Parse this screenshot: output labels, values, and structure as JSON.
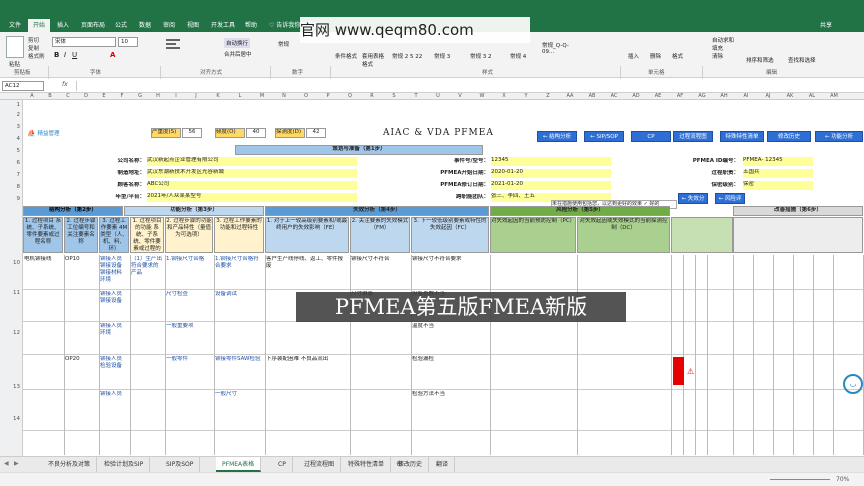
{
  "window": {
    "title": "PFMEA第五版FMEA新版 - Excel",
    "user": "共享"
  },
  "ribbon_tabs": [
    "文件",
    "开始",
    "插入",
    "页面布局",
    "公式",
    "数据",
    "审阅",
    "视图",
    "开发工具",
    "帮助",
    "♡ 告诉我你想要做什么"
  ],
  "ribbon": {
    "clipboard": "剪贴板",
    "paste": "粘贴",
    "cut": "剪切",
    "copy": "复制",
    "format_painter": "格式刷",
    "font_group": "字体",
    "font_name": "宋体",
    "font_size": "10",
    "align_group": "对齐方式",
    "wrap": "自动换行",
    "merge": "合并后居中",
    "number_group": "数字",
    "number_format": "常规",
    "styles_group": "样式",
    "cond_format": "条件格式",
    "table_format": "套用表格格式",
    "style_names": [
      "常规 2 5 22",
      "常规 3",
      "常规 3 2",
      "常规 4",
      "常规_Q-Q-09..."
    ],
    "cells_group": "单元格",
    "insert": "插入",
    "delete": "删除",
    "format": "格式",
    "editing_group": "编辑",
    "autosum": "自动求和",
    "fill": "填充",
    "clear": "清除",
    "sort": "排序和筛选",
    "find": "查找和选择"
  },
  "watermark_top": "官网 www.qeqm80.com",
  "watermark_mid": "PFMEA第五版FMEA新版",
  "formula_bar": {
    "name_box": "AC12",
    "fx": "fx"
  },
  "columns": [
    "A",
    "B",
    "C",
    "D",
    "E",
    "F",
    "G",
    "H",
    "I",
    "J",
    "K",
    "L",
    "M",
    "N",
    "O",
    "P",
    "Q",
    "R",
    "S",
    "T",
    "U",
    "V",
    "W",
    "X",
    "Y",
    "Z",
    "AA",
    "AB",
    "AC",
    "AD",
    "AE",
    "AF",
    "AG",
    "AH",
    "AI",
    "AJ",
    "AK",
    "AL",
    "AM",
    "AN"
  ],
  "rows": [
    "1",
    "2",
    "3",
    "4",
    "5",
    "6",
    "7",
    "8",
    "9",
    "10",
    "11",
    "12",
    "13",
    "14"
  ],
  "sheet": {
    "logo": "精益管理",
    "sev_label": "严重度(S)",
    "sev_val": "56",
    "occ_label": "频度(O)",
    "occ_val": "40",
    "det_label": "探测度(D)",
    "det_val": "42",
    "main_title": "AIAC & VDA PFMEA",
    "nav_buttons": [
      "← 结构分析",
      "← SIP/SOP",
      "CP",
      "过程流程图",
      "特殊特性清单",
      "修改历史",
      "← 功能分析",
      "← 失效分析",
      "← 风险评估",
      "← 优化"
    ],
    "plan_header": "策划与准备（第1步）",
    "labels": {
      "company": "公司名称：",
      "company_val": "武汉新起点企业管理有限公司",
      "location": "制造地址：",
      "location_val": "武汉东湖新技术开发区光谷新城",
      "customer": "顾客名称：",
      "customer_val": "ABC公司",
      "model": "年型/平台：",
      "model_val": "2021年/人众某某型号",
      "item": "事件号/型号：",
      "item_val": "12345",
      "start": "PFMEA开始日期：",
      "start_val": "2020-01-20",
      "revise": "PFMEA修订日期：",
      "revise_val": "2021-01-20",
      "team": "跨职能团队：",
      "team_val": "张三、李四、王五",
      "id": "PFMEA ID编号：",
      "id_val": "PFMEA- 12345",
      "owner": "过程职责：",
      "owner_val": "五国兵",
      "security": "保密级别：",
      "security_val": "保密"
    },
    "hint": "未在措施使用包括您，以达到更好的效果 ✓ 好的",
    "section_headers": {
      "structure": "结构分析（第2步）",
      "function": "功能分析（第3步）",
      "failure": "失效分析（第4步）",
      "risk": "风险分析（第5步）",
      "optimize": "改善措施（第6步）"
    },
    "col_headers": [
      "1. 过程项目 系统、子系统、零件要素或过程名称",
      "2. 过程步骤 工位编号和关注要素名称",
      "3. 过程工作要素 4M类型（人、机、料、环）",
      "1. 过程项目的功能 系统、子系统、零件要素或过程的功能",
      "2. 过程步骤的功能和产品特性（量值为可选项）",
      "3. 过程工作要素的功能和过程特性",
      "1. 对于上一较高级别要素和/或最终用户的失效影响（FE）",
      "2. 关注要素的失效模式（FM）",
      "3. 下一较低级别要素或特性的失效起因（FC）",
      "对失效起因的当前预防控制（PC）",
      "对失效起因或失效模式的当前探测控制（DC）"
    ],
    "rows_data": [
      [
        "电机铆接线",
        "OP10",
        "铆接人员 铆接设备 铆接材料 环境",
        "（1）生产出符合要求的产品",
        "1.铆接尺寸合格",
        "1.铆接尺寸合格符合要求",
        "客户生产线停线、返工、零件报废",
        "铆接尺寸不符合",
        "铆接尺寸不符合要求"
      ],
      [
        "",
        "",
        "铆接人员 铆接设备",
        "",
        "尺寸检查",
        "设备调试",
        "",
        "尺寸偏离",
        "设备参数不当"
      ],
      [
        "",
        "",
        "铆接人员 环境",
        "",
        "一般重要项",
        "",
        "",
        "",
        "温度不当"
      ],
      [
        "",
        "OP20",
        "铆接人员 检验设备",
        "",
        "一般零件",
        "铆接零件SAW检验",
        "下序装配困难 不良品流出",
        "",
        "检验漏检"
      ],
      [
        "",
        "",
        "铆接人员",
        "",
        "",
        "一般尺寸",
        "",
        "",
        "检验方法不当"
      ]
    ]
  },
  "sheet_tabs": [
    "不良分析及对策",
    "检验计划及SIP",
    "SIP及SOP",
    "PFMEA表格",
    "CP",
    "过程流程图",
    "特殊特性清单",
    "修改历史",
    "翻译"
  ],
  "status": {
    "zoom": "70%"
  }
}
